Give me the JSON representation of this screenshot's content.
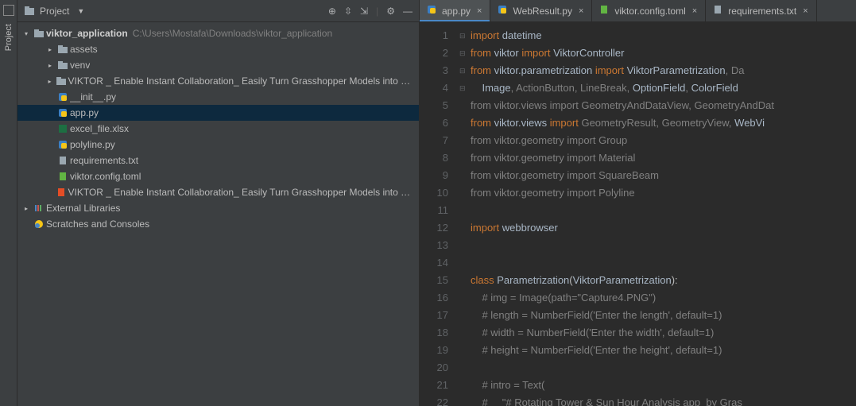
{
  "rail": {
    "project_label": "Project"
  },
  "project_header": {
    "title": "Project"
  },
  "tree": {
    "root": {
      "name": "viktor_application",
      "path": "C:\\Users\\Mostafa\\Downloads\\viktor_application"
    },
    "children": [
      {
        "type": "folder",
        "name": "assets",
        "indent": 2,
        "expandable": true
      },
      {
        "type": "folder",
        "name": "venv",
        "indent": 2,
        "expandable": true
      },
      {
        "type": "folder",
        "name": "VIKTOR _ Enable Instant Collaboration_ Easily Turn Grasshopper Models into Web App…",
        "indent": 2,
        "expandable": true
      },
      {
        "type": "py",
        "name": "__init__.py",
        "indent": 2
      },
      {
        "type": "py",
        "name": "app.py",
        "indent": 2,
        "selected": true
      },
      {
        "type": "xlsx",
        "name": "excel_file.xlsx",
        "indent": 2
      },
      {
        "type": "py",
        "name": "polyline.py",
        "indent": 2
      },
      {
        "type": "txt",
        "name": "requirements.txt",
        "indent": 2
      },
      {
        "type": "toml",
        "name": "viktor.config.toml",
        "indent": 2
      },
      {
        "type": "html",
        "name": "VIKTOR _ Enable Instant Collaboration_ Easily Turn Grasshopper Models into Web App…",
        "indent": 2
      },
      {
        "type": "lib",
        "name": "External Libraries",
        "indent": 0,
        "expandable": true
      },
      {
        "type": "scratch",
        "name": "Scratches and Consoles",
        "indent": 0
      }
    ]
  },
  "tabs": [
    {
      "name": "app.py",
      "icon": "py",
      "active": true
    },
    {
      "name": "WebResult.py",
      "icon": "py"
    },
    {
      "name": "viktor.config.toml",
      "icon": "toml"
    },
    {
      "name": "requirements.txt",
      "icon": "txt"
    }
  ],
  "code_lines": [
    {
      "n": 1,
      "fold": "-",
      "html": "<span class='kw'>import</span> <span class='id'>datetime</span>"
    },
    {
      "n": 2,
      "html": "<span class='kw'>from</span> <span class='id'>viktor</span> <span class='kw'>import</span> <span class='id'>ViktorController</span>"
    },
    {
      "n": 3,
      "html": "<span class='kw'>from</span> <span class='id'>viktor.parametrization</span> <span class='kw'>import</span> <span class='id'>ViktorParametrization</span><span class='cm'>, Da</span>"
    },
    {
      "n": 4,
      "html": "    <span class='id'>Image</span><span class='cm'>, ActionButton, LineBreak,</span> <span class='id'>OptionField</span><span class='cm'>,</span> <span class='id'>ColorField</span>"
    },
    {
      "n": 5,
      "html": "<span class='cm'>from viktor.views import GeometryAndDataView, GeometryAndDat</span>"
    },
    {
      "n": 6,
      "html": "<span class='kw'>from</span> <span class='id'>viktor.views</span> <span class='kw'>import</span> <span class='cm'>GeometryResult, GeometryView,</span> <span class='id'>WebVi</span>"
    },
    {
      "n": 7,
      "html": "<span class='cm'>from viktor.geometry import Group</span>"
    },
    {
      "n": 8,
      "html": "<span class='cm'>from viktor.geometry import Material</span>"
    },
    {
      "n": 9,
      "html": "<span class='cm'>from viktor.geometry import SquareBeam</span>"
    },
    {
      "n": 10,
      "html": "<span class='cm'>from viktor.geometry import Polyline</span>"
    },
    {
      "n": 11,
      "html": ""
    },
    {
      "n": 12,
      "fold": "-",
      "html": "<span class='kw'>import</span> <span class='id'>webbrowser</span>"
    },
    {
      "n": 13,
      "html": ""
    },
    {
      "n": 14,
      "html": ""
    },
    {
      "n": 15,
      "fold": "-",
      "html": "<span class='kw'>class</span> <span class='cls'>Parametrization</span>(<span class='id'>ViktorParametrization</span>):"
    },
    {
      "n": 16,
      "fold": "-",
      "html": "    <span class='cm'># img = Image(path=\"Capture4.PNG\")</span>"
    },
    {
      "n": 17,
      "html": "    <span class='cm'># length = NumberField('Enter the length', default=1)</span>"
    },
    {
      "n": 18,
      "html": "    <span class='cm'># width = NumberField('Enter the width', default=1)</span>"
    },
    {
      "n": 19,
      "html": "    <span class='cm'># height = NumberField('Enter the height', default=1)</span>"
    },
    {
      "n": 20,
      "html": ""
    },
    {
      "n": 21,
      "html": "    <span class='cm'># intro = Text(</span>"
    },
    {
      "n": 22,
      "html": "    <span class='cm'>#     \"# Rotating Tower & Sun Hour Analysis app  by Gras</span>"
    }
  ]
}
